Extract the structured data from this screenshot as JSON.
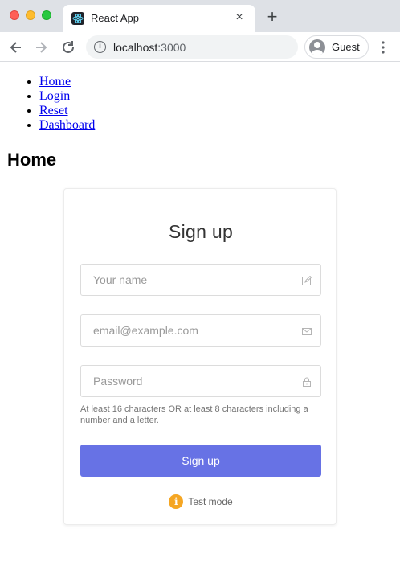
{
  "browser": {
    "tab_title": "React App",
    "tab_close": "×",
    "new_tab": "+",
    "url_host": "localhost",
    "url_port": ":3000",
    "profile_label": "Guest"
  },
  "nav": {
    "items": [
      {
        "label": "Home"
      },
      {
        "label": "Login"
      },
      {
        "label": "Reset"
      },
      {
        "label": "Dashboard"
      }
    ]
  },
  "page": {
    "heading": "Home"
  },
  "signup": {
    "title": "Sign up",
    "name_placeholder": "Your name",
    "email_placeholder": "email@example.com",
    "password_placeholder": "Password",
    "password_hint": "At least 16 characters OR at least 8 characters including a number and a letter.",
    "submit_label": "Sign up",
    "test_mode_label": "Test mode",
    "accent_color": "#6772e5",
    "test_mode_color": "#f5a623"
  }
}
